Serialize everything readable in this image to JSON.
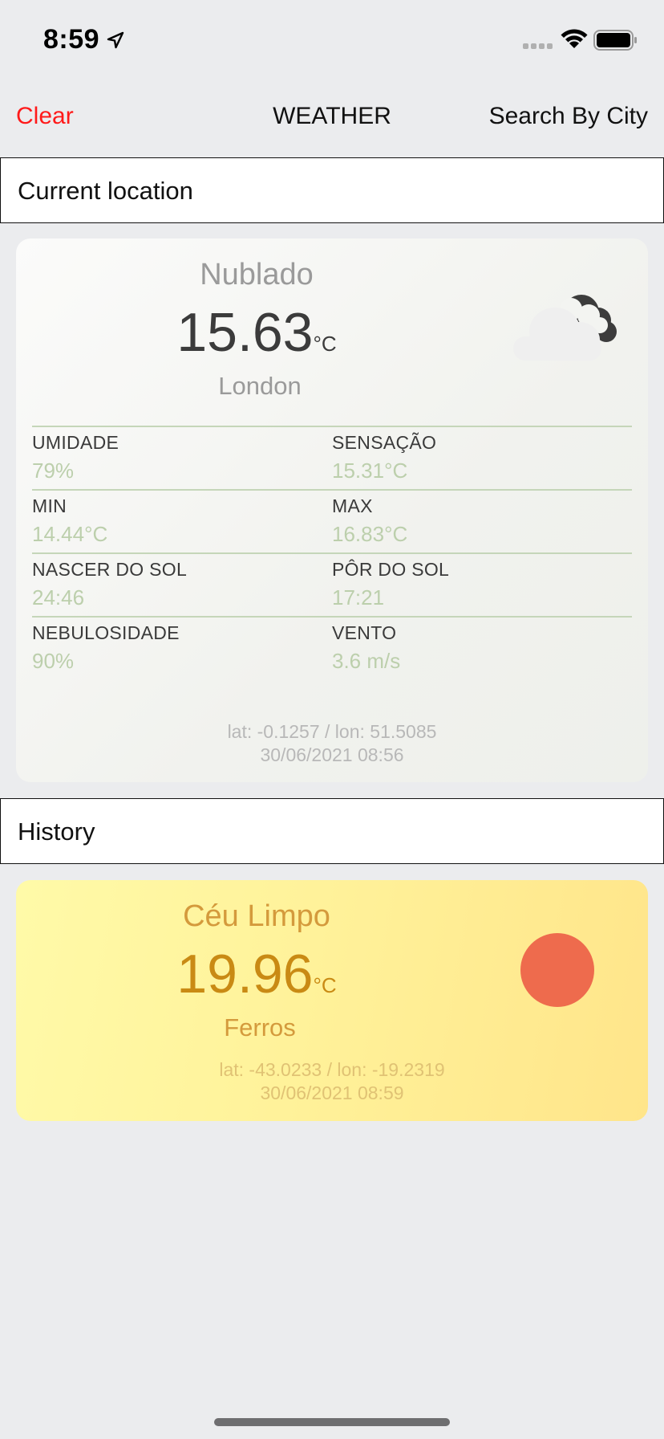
{
  "status_bar": {
    "time": "8:59"
  },
  "nav": {
    "clear_label": "Clear",
    "title": "WEATHER",
    "search_label": "Search By City"
  },
  "current_section": {
    "title": "Current location"
  },
  "current": {
    "condition": "Nublado",
    "temperature": "15.63",
    "unit": "°C",
    "city": "London",
    "icon": "cloud-moon-icon",
    "details": [
      {
        "label": "UMIDADE",
        "value": "79%"
      },
      {
        "label": "SENSAÇÃO",
        "value": "15.31°C"
      },
      {
        "label": "MIN",
        "value": "14.44°C"
      },
      {
        "label": "MAX",
        "value": "16.83°C"
      },
      {
        "label": "NASCER DO SOL",
        "value": "24:46"
      },
      {
        "label": "PÔR DO SOL",
        "value": "17:21"
      },
      {
        "label": "NEBULOSIDADE",
        "value": "90%"
      },
      {
        "label": "VENTO",
        "value": "3.6 m/s"
      }
    ],
    "coords": "lat: -0.1257 / lon: 51.5085",
    "timestamp": "30/06/2021 08:56"
  },
  "history_section": {
    "title": "History"
  },
  "history": [
    {
      "condition": "Céu Limpo",
      "temperature": "19.96",
      "unit": "°C",
      "city": "Ferros",
      "icon": "sun-icon",
      "coords": "lat: -43.0233 / lon: -19.2319",
      "timestamp": "30/06/2021 08:59"
    }
  ],
  "colors": {
    "clear": "#ff1a1a",
    "current_text": "#9a9a9a",
    "history_text": "#d49a3c",
    "history_temp": "#c98a14",
    "sun": "#ee6b4d"
  }
}
